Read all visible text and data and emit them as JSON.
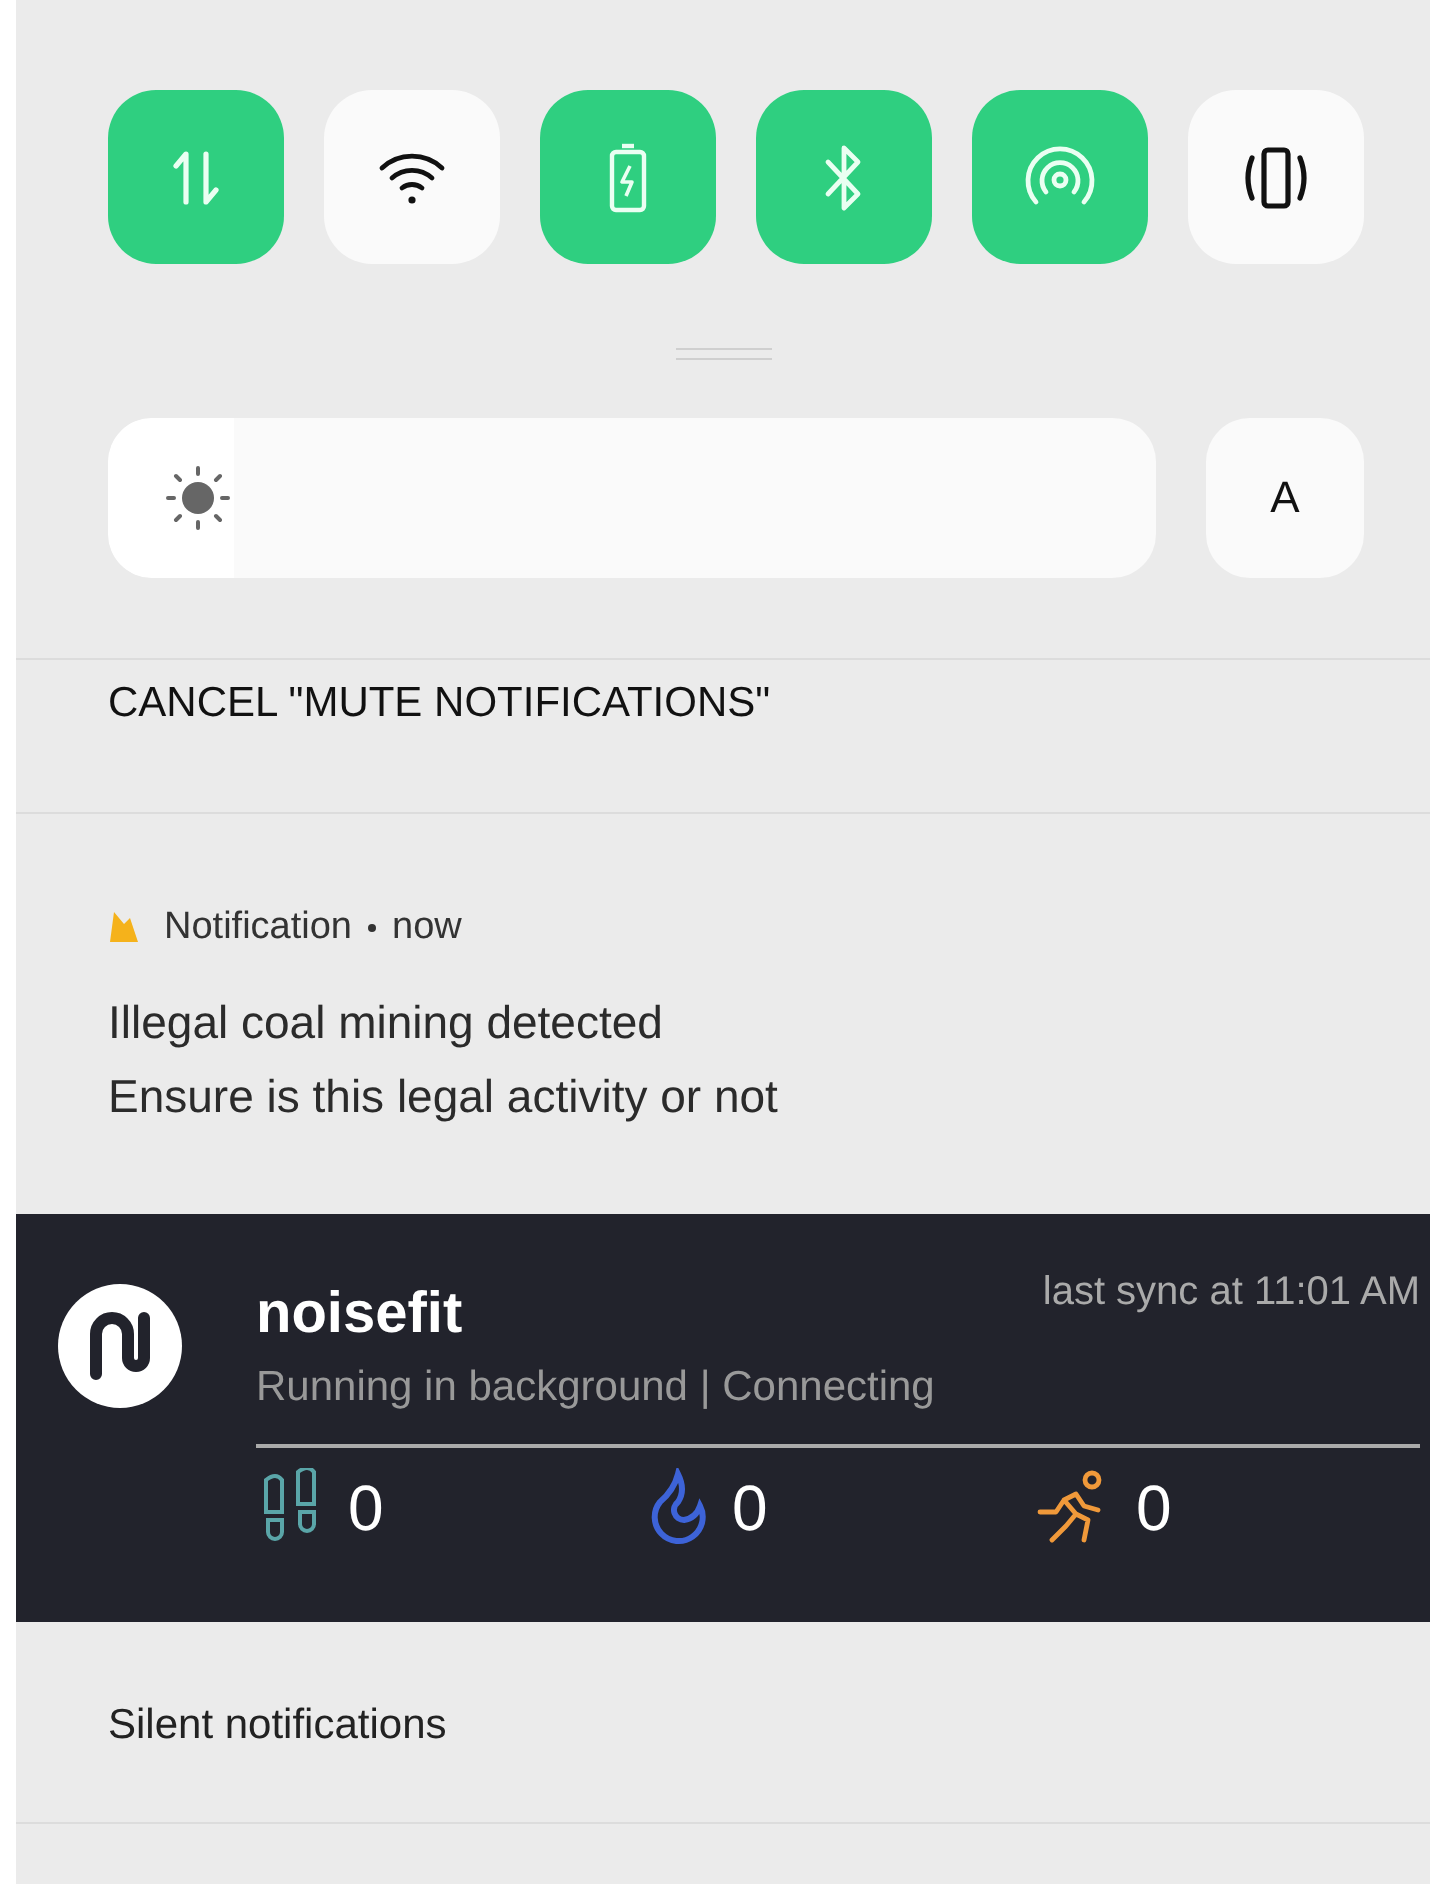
{
  "quick_tiles": [
    {
      "kind": "data",
      "on": true
    },
    {
      "kind": "wifi",
      "on": false
    },
    {
      "kind": "battery",
      "on": true
    },
    {
      "kind": "bluetooth",
      "on": true
    },
    {
      "kind": "hotspot",
      "on": true
    },
    {
      "kind": "vibrate",
      "on": false
    }
  ],
  "brightness": {
    "level": 0.12
  },
  "auto_brightness_label": "A",
  "cancel_action": "CANCEL \"MUTE NOTIFICATIONS\"",
  "notification": {
    "app": "Notification",
    "time": "now",
    "title": "Illegal coal mining detected",
    "body": "Ensure is this legal activity or not"
  },
  "noisefit": {
    "name": "noisefit",
    "sync": "last sync at 11:01 AM",
    "status": "Running in background | Connecting",
    "stats": [
      {
        "kind": "steps",
        "value": "0"
      },
      {
        "kind": "calories",
        "value": "0"
      },
      {
        "kind": "activity",
        "value": "0"
      }
    ]
  },
  "silent_section": "Silent notifications"
}
